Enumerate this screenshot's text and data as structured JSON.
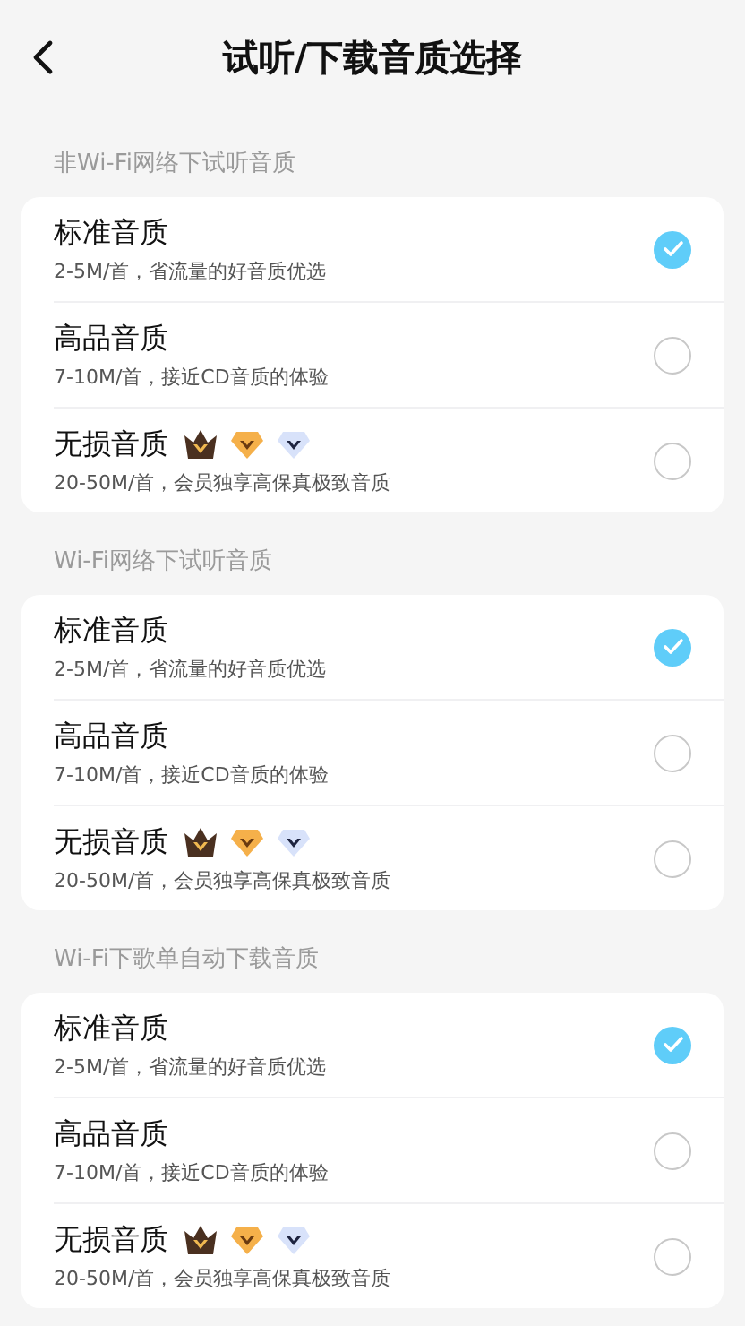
{
  "header": {
    "title": "试听/下载音质选择"
  },
  "sections": [
    {
      "label": "非Wi-Fi网络下试听音质",
      "options": [
        {
          "title": "标准音质",
          "desc": "2-5M/首，省流量的好音质优选",
          "badges": false,
          "selected": true
        },
        {
          "title": "高品音质",
          "desc": "7-10M/首，接近CD音质的体验",
          "badges": false,
          "selected": false
        },
        {
          "title": "无损音质",
          "desc": "20-50M/首，会员独享高保真极致音质",
          "badges": true,
          "selected": false
        }
      ]
    },
    {
      "label": "Wi-Fi网络下试听音质",
      "options": [
        {
          "title": "标准音质",
          "desc": "2-5M/首，省流量的好音质优选",
          "badges": false,
          "selected": true
        },
        {
          "title": "高品音质",
          "desc": "7-10M/首，接近CD音质的体验",
          "badges": false,
          "selected": false
        },
        {
          "title": "无损音质",
          "desc": "20-50M/首，会员独享高保真极致音质",
          "badges": true,
          "selected": false
        }
      ]
    },
    {
      "label": "Wi-Fi下歌单自动下载音质",
      "options": [
        {
          "title": "标准音质",
          "desc": "2-5M/首，省流量的好音质优选",
          "badges": false,
          "selected": true
        },
        {
          "title": "高品音质",
          "desc": "7-10M/首，接近CD音质的体验",
          "badges": false,
          "selected": false
        },
        {
          "title": "无损音质",
          "desc": "20-50M/首，会员独享高保真极致音质",
          "badges": true,
          "selected": false
        }
      ]
    }
  ]
}
